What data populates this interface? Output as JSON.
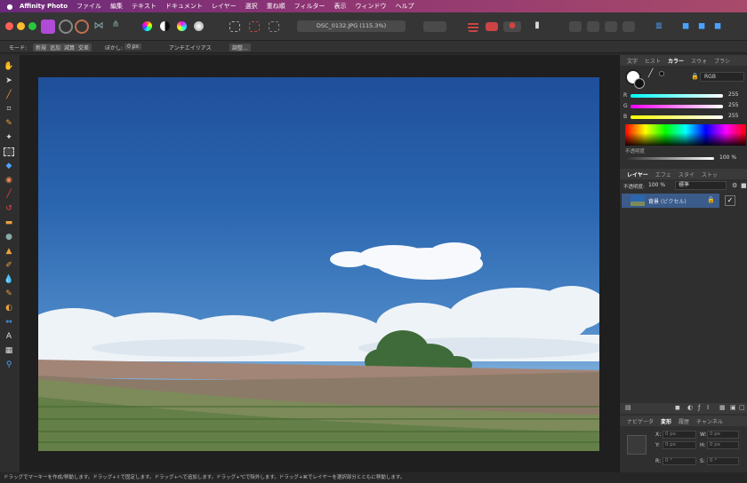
{
  "menubar": {
    "app_name": "Affinity Photo",
    "items": [
      "ファイル",
      "編集",
      "テキスト",
      "ドキュメント",
      "レイヤー",
      "選択",
      "重ね順",
      "フィルター",
      "表示",
      "ウィンドウ",
      "ヘルプ"
    ]
  },
  "document_tab": {
    "title": "DSC_0132.JPG (115.3%)"
  },
  "context_toolbar": {
    "mode_label": "モード:",
    "mode_options": [
      "新規",
      "追加",
      "減算",
      "交差"
    ],
    "feather_label": "ぼかし:",
    "feather_value": "0 px",
    "antialias_label": "アンチエイリアス",
    "adjust_label": "調整..."
  },
  "color_panel": {
    "tabs": [
      "文字",
      "ヒスト",
      "カラー",
      "スウォ",
      "ブラシ"
    ],
    "active_tab": "カラー",
    "model": "RGB",
    "channels": [
      {
        "name": "R",
        "value": "255"
      },
      {
        "name": "G",
        "value": "255"
      },
      {
        "name": "B",
        "value": "255"
      }
    ],
    "opacity_label": "不透明度",
    "opacity_value": "100 %"
  },
  "layers_panel": {
    "tabs": [
      "レイヤー",
      "エフェ",
      "スタイ",
      "ストッ"
    ],
    "active_tab": "レイヤー",
    "opacity_label": "不透明度:",
    "opacity_value": "100 %",
    "blend_mode": "標準",
    "layers": [
      {
        "name": "背景",
        "type": "(ピクセル)"
      }
    ]
  },
  "transform_panel": {
    "tabs": [
      "ナビゲータ",
      "変形",
      "履歴",
      "チャンネル"
    ],
    "active_tab": "変形",
    "fields": [
      {
        "label": "X:",
        "value": "0 px"
      },
      {
        "label": "W:",
        "value": "0 px"
      },
      {
        "label": "Y:",
        "value": "0 px"
      },
      {
        "label": "H:",
        "value": "0 px"
      },
      {
        "label": "R:",
        "value": "0 °"
      },
      {
        "label": "S:",
        "value": "0 °"
      }
    ]
  },
  "status_bar": {
    "text": "ドラッグでマーキーを作成/移動します。ドラッグ+⇧で固定します。ドラッグ+へで追加します。ドラッグ+℃で除外します。ドラッグ+⌘でレイヤーを選択部分とともに移動します。"
  },
  "colors": {
    "menubar_accent": "#8c3474",
    "canvas_bg": "#1f1f1f",
    "selected_layer": "#3b5b8a"
  }
}
